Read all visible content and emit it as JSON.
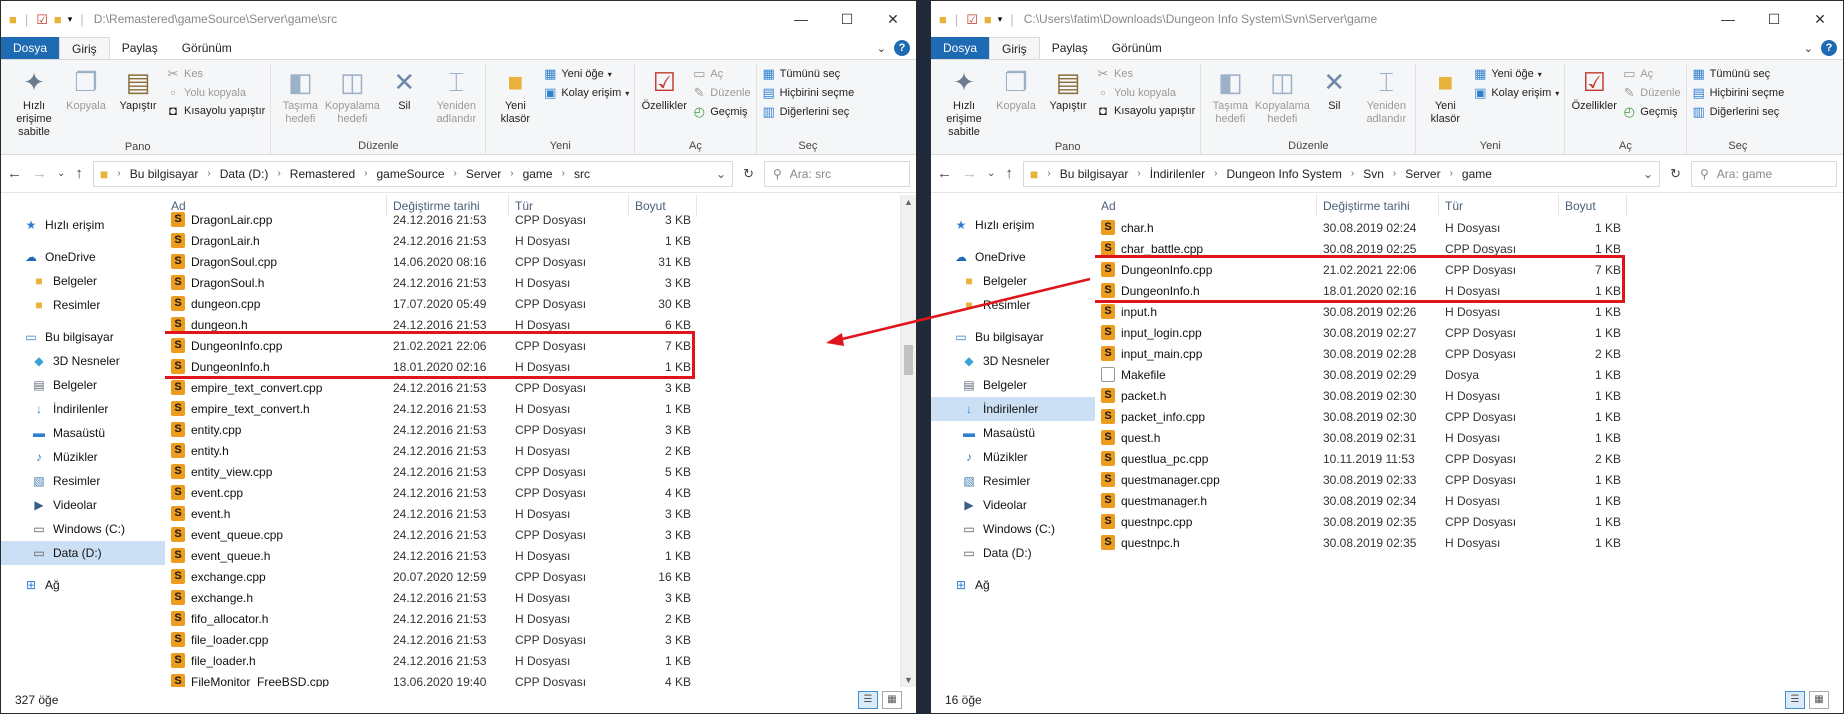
{
  "windows": [
    {
      "title": "D:\\Remastered\\gameSource\\Server\\game\\src",
      "tabs": [
        "Dosya",
        "Giriş",
        "Paylaş",
        "Görünüm"
      ],
      "ribbon": {
        "pano": {
          "name": "Pano",
          "pin": "Hızlı erişime sabitle",
          "copy": "Kopyala",
          "paste": "Yapıştır",
          "cut": "Kes",
          "copy_path": "Yolu kopyala",
          "paste_shortcut": "Kısayolu yapıştır"
        },
        "duzenle": {
          "name": "Düzenle",
          "move": "Taşıma hedefi",
          "copyto": "Kopyalama hedefi",
          "delete": "Sil",
          "rename": "Yeniden adlandır"
        },
        "yeni": {
          "name": "Yeni",
          "newfolder": "Yeni klasör",
          "newitem": "Yeni öğe",
          "easyaccess": "Kolay erişim"
        },
        "ac": {
          "name": "Aç",
          "props": "Özellikler",
          "open": "Aç",
          "edit": "Düzenle",
          "history": "Geçmiş"
        },
        "sec": {
          "name": "Seç",
          "all": "Tümünü seç",
          "none": "Hiçbirini seçme",
          "invert": "Diğerlerini seç"
        }
      },
      "breadcrumb": [
        "Bu bilgisayar",
        "Data (D:)",
        "Remastered",
        "gameSource",
        "Server",
        "game",
        "src"
      ],
      "search_placeholder": "Ara: src",
      "nav": [
        {
          "label": "Hızlı erişim",
          "icon": "star-icon",
          "level": 0
        },
        {
          "label": "OneDrive",
          "icon": "cloud-icon",
          "level": 0,
          "gap": true
        },
        {
          "label": "Belgeler",
          "icon": "folder-icon",
          "level": 1
        },
        {
          "label": "Resimler",
          "icon": "folder-icon",
          "level": 1
        },
        {
          "label": "Bu bilgisayar",
          "icon": "computer-icon",
          "level": 0,
          "gap": true
        },
        {
          "label": "3D Nesneler",
          "icon": "cube-icon",
          "level": 1
        },
        {
          "label": "Belgeler",
          "icon": "documents-icon",
          "level": 1
        },
        {
          "label": "İndirilenler",
          "icon": "download-icon",
          "level": 1
        },
        {
          "label": "Masaüstü",
          "icon": "desktop-icon",
          "level": 1
        },
        {
          "label": "Müzikler",
          "icon": "music-icon",
          "level": 1
        },
        {
          "label": "Resimler",
          "icon": "pictures-icon",
          "level": 1
        },
        {
          "label": "Videolar",
          "icon": "video-icon",
          "level": 1
        },
        {
          "label": "Windows (C:)",
          "icon": "drive-icon",
          "level": 1
        },
        {
          "label": "Data (D:)",
          "icon": "drive-icon",
          "level": 1,
          "selected": true
        },
        {
          "label": "Ağ",
          "icon": "network-icon",
          "level": 0,
          "gap": true
        }
      ],
      "columns": [
        "Ad",
        "Değiştirme tarihi",
        "Tür",
        "Boyut"
      ],
      "files": [
        {
          "name": "DragonLair.cpp",
          "date": "24.12.2016 21:53",
          "type": "CPP Dosyası",
          "size": "3 KB"
        },
        {
          "name": "DragonLair.h",
          "date": "24.12.2016 21:53",
          "type": "H Dosyası",
          "size": "1 KB"
        },
        {
          "name": "DragonSoul.cpp",
          "date": "14.06.2020 08:16",
          "type": "CPP Dosyası",
          "size": "31 KB"
        },
        {
          "name": "DragonSoul.h",
          "date": "24.12.2016 21:53",
          "type": "H Dosyası",
          "size": "3 KB"
        },
        {
          "name": "dungeon.cpp",
          "date": "17.07.2020 05:49",
          "type": "CPP Dosyası",
          "size": "30 KB"
        },
        {
          "name": "dungeon.h",
          "date": "24.12.2016 21:53",
          "type": "H Dosyası",
          "size": "6 KB"
        },
        {
          "name": "DungeonInfo.cpp",
          "date": "21.02.2021 22:06",
          "type": "CPP Dosyası",
          "size": "7 KB"
        },
        {
          "name": "DungeonInfo.h",
          "date": "18.01.2020 02:16",
          "type": "H Dosyası",
          "size": "1 KB"
        },
        {
          "name": "empire_text_convert.cpp",
          "date": "24.12.2016 21:53",
          "type": "CPP Dosyası",
          "size": "3 KB"
        },
        {
          "name": "empire_text_convert.h",
          "date": "24.12.2016 21:53",
          "type": "H Dosyası",
          "size": "1 KB"
        },
        {
          "name": "entity.cpp",
          "date": "24.12.2016 21:53",
          "type": "CPP Dosyası",
          "size": "3 KB"
        },
        {
          "name": "entity.h",
          "date": "24.12.2016 21:53",
          "type": "H Dosyası",
          "size": "2 KB"
        },
        {
          "name": "entity_view.cpp",
          "date": "24.12.2016 21:53",
          "type": "CPP Dosyası",
          "size": "5 KB"
        },
        {
          "name": "event.cpp",
          "date": "24.12.2016 21:53",
          "type": "CPP Dosyası",
          "size": "4 KB"
        },
        {
          "name": "event.h",
          "date": "24.12.2016 21:53",
          "type": "H Dosyası",
          "size": "3 KB"
        },
        {
          "name": "event_queue.cpp",
          "date": "24.12.2016 21:53",
          "type": "CPP Dosyası",
          "size": "3 KB"
        },
        {
          "name": "event_queue.h",
          "date": "24.12.2016 21:53",
          "type": "H Dosyası",
          "size": "1 KB"
        },
        {
          "name": "exchange.cpp",
          "date": "20.07.2020 12:59",
          "type": "CPP Dosyası",
          "size": "16 KB"
        },
        {
          "name": "exchange.h",
          "date": "24.12.2016 21:53",
          "type": "H Dosyası",
          "size": "3 KB"
        },
        {
          "name": "fifo_allocator.h",
          "date": "24.12.2016 21:53",
          "type": "H Dosyası",
          "size": "2 KB"
        },
        {
          "name": "file_loader.cpp",
          "date": "24.12.2016 21:53",
          "type": "CPP Dosyası",
          "size": "3 KB"
        },
        {
          "name": "file_loader.h",
          "date": "24.12.2016 21:53",
          "type": "H Dosyası",
          "size": "1 KB"
        },
        {
          "name": "FileMonitor_FreeBSD.cpp",
          "date": "13.06.2020 19:40",
          "type": "CPP Dosyası",
          "size": "4 KB"
        }
      ],
      "highlight": [
        6,
        7
      ],
      "status": "327 öğe"
    },
    {
      "title": "C:\\Users\\fatim\\Downloads\\Dungeon Info System\\Svn\\Server\\game",
      "tabs": [
        "Dosya",
        "Giriş",
        "Paylaş",
        "Görünüm"
      ],
      "ribbon": {
        "pano": {
          "name": "Pano",
          "pin": "Hızlı erişime sabitle",
          "copy": "Kopyala",
          "paste": "Yapıştır",
          "cut": "Kes",
          "copy_path": "Yolu kopyala",
          "paste_shortcut": "Kısayolu yapıştır"
        },
        "duzenle": {
          "name": "Düzenle",
          "move": "Taşıma hedefi",
          "copyto": "Kopyalama hedefi",
          "delete": "Sil",
          "rename": "Yeniden adlandır"
        },
        "yeni": {
          "name": "Yeni",
          "newfolder": "Yeni klasör",
          "newitem": "Yeni öğe",
          "easyaccess": "Kolay erişim"
        },
        "ac": {
          "name": "Aç",
          "props": "Özellikler",
          "open": "Aç",
          "edit": "Düzenle",
          "history": "Geçmiş"
        },
        "sec": {
          "name": "Seç",
          "all": "Tümünü seç",
          "none": "Hiçbirini seçme",
          "invert": "Diğerlerini seç"
        }
      },
      "breadcrumb": [
        "Bu bilgisayar",
        "İndirilenler",
        "Dungeon Info System",
        "Svn",
        "Server",
        "game"
      ],
      "search_placeholder": "Ara: game",
      "nav": [
        {
          "label": "Hızlı erişim",
          "icon": "star-icon",
          "level": 0
        },
        {
          "label": "OneDrive",
          "icon": "cloud-icon",
          "level": 0,
          "gap": true
        },
        {
          "label": "Belgeler",
          "icon": "folder-icon",
          "level": 1
        },
        {
          "label": "Resimler",
          "icon": "folder-icon",
          "level": 1
        },
        {
          "label": "Bu bilgisayar",
          "icon": "computer-icon",
          "level": 0,
          "gap": true
        },
        {
          "label": "3D Nesneler",
          "icon": "cube-icon",
          "level": 1
        },
        {
          "label": "Belgeler",
          "icon": "documents-icon",
          "level": 1
        },
        {
          "label": "İndirilenler",
          "icon": "download-icon",
          "level": 1,
          "selected": true
        },
        {
          "label": "Masaüstü",
          "icon": "desktop-icon",
          "level": 1
        },
        {
          "label": "Müzikler",
          "icon": "music-icon",
          "level": 1
        },
        {
          "label": "Resimler",
          "icon": "pictures-icon",
          "level": 1
        },
        {
          "label": "Videolar",
          "icon": "video-icon",
          "level": 1
        },
        {
          "label": "Windows (C:)",
          "icon": "drive-icon",
          "level": 1
        },
        {
          "label": "Data (D:)",
          "icon": "drive-icon",
          "level": 1
        },
        {
          "label": "Ağ",
          "icon": "network-icon",
          "level": 0,
          "gap": true
        }
      ],
      "columns": [
        "Ad",
        "Değiştirme tarihi",
        "Tür",
        "Boyut"
      ],
      "files": [
        {
          "name": "char.h",
          "date": "30.08.2019 02:24",
          "type": "H Dosyası",
          "size": "1 KB"
        },
        {
          "name": "char_battle.cpp",
          "date": "30.08.2019 02:25",
          "type": "CPP Dosyası",
          "size": "1 KB"
        },
        {
          "name": "DungeonInfo.cpp",
          "date": "21.02.2021 22:06",
          "type": "CPP Dosyası",
          "size": "7 KB"
        },
        {
          "name": "DungeonInfo.h",
          "date": "18.01.2020 02:16",
          "type": "H Dosyası",
          "size": "1 KB"
        },
        {
          "name": "input.h",
          "date": "30.08.2019 02:26",
          "type": "H Dosyası",
          "size": "1 KB"
        },
        {
          "name": "input_login.cpp",
          "date": "30.08.2019 02:27",
          "type": "CPP Dosyası",
          "size": "1 KB"
        },
        {
          "name": "input_main.cpp",
          "date": "30.08.2019 02:28",
          "type": "CPP Dosyası",
          "size": "2 KB"
        },
        {
          "name": "Makefile",
          "date": "30.08.2019 02:29",
          "type": "Dosya",
          "size": "1 KB",
          "plain": true
        },
        {
          "name": "packet.h",
          "date": "30.08.2019 02:30",
          "type": "H Dosyası",
          "size": "1 KB"
        },
        {
          "name": "packet_info.cpp",
          "date": "30.08.2019 02:30",
          "type": "CPP Dosyası",
          "size": "1 KB"
        },
        {
          "name": "quest.h",
          "date": "30.08.2019 02:31",
          "type": "H Dosyası",
          "size": "1 KB"
        },
        {
          "name": "questlua_pc.cpp",
          "date": "10.11.2019 11:53",
          "type": "CPP Dosyası",
          "size": "2 KB"
        },
        {
          "name": "questmanager.cpp",
          "date": "30.08.2019 02:33",
          "type": "CPP Dosyası",
          "size": "1 KB"
        },
        {
          "name": "questmanager.h",
          "date": "30.08.2019 02:34",
          "type": "H Dosyası",
          "size": "1 KB"
        },
        {
          "name": "questnpc.cpp",
          "date": "30.08.2019 02:35",
          "type": "CPP Dosyası",
          "size": "1 KB"
        },
        {
          "name": "questnpc.h",
          "date": "30.08.2019 02:35",
          "type": "H Dosyası",
          "size": "1 KB"
        }
      ],
      "highlight": [
        2,
        3
      ],
      "status": "16 öğe"
    }
  ]
}
